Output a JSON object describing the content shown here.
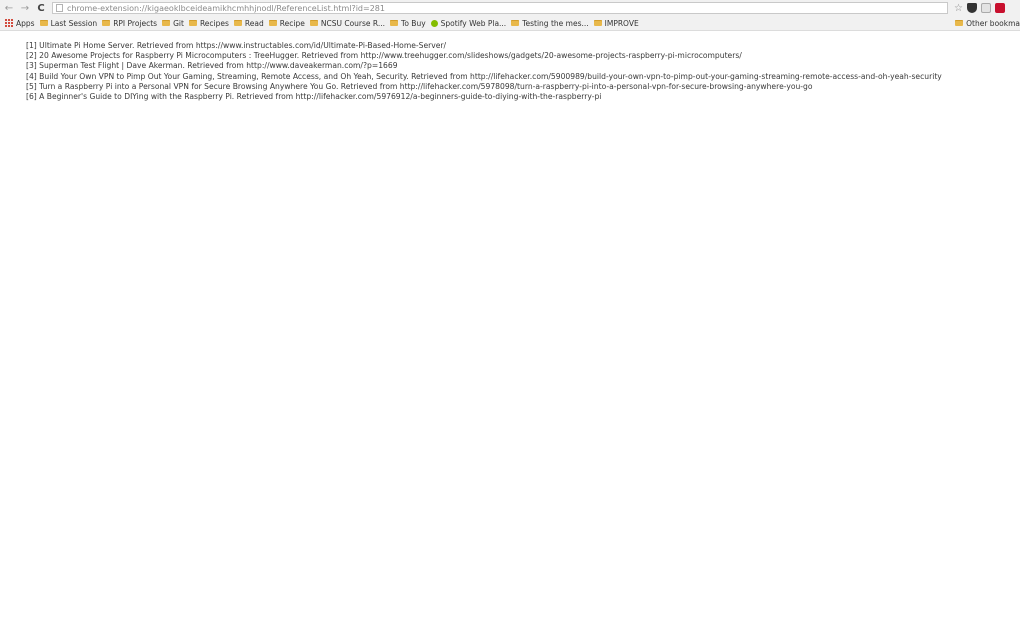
{
  "browser": {
    "back_icon": "←",
    "forward_icon": "→",
    "reload_icon": "C",
    "url": "chrome-extension://kigaeoklbceideamikhcmhhjnodl/ReferenceList.html?id=281",
    "star_icon": "☆"
  },
  "bookmarks": {
    "items": [
      {
        "label": "Apps",
        "type": "apps"
      },
      {
        "label": "Last Session",
        "type": "folder"
      },
      {
        "label": "RPI Projects",
        "type": "folder"
      },
      {
        "label": "Git",
        "type": "folder"
      },
      {
        "label": "Recipes",
        "type": "folder"
      },
      {
        "label": "Read",
        "type": "folder"
      },
      {
        "label": "Recipe",
        "type": "folder"
      },
      {
        "label": "NCSU Course R...",
        "type": "folder"
      },
      {
        "label": "To Buy",
        "type": "folder"
      },
      {
        "label": "Spotify Web Pla...",
        "type": "spotify"
      },
      {
        "label": "Testing the mes...",
        "type": "folder"
      },
      {
        "label": "IMPROVE",
        "type": "folder"
      }
    ],
    "other": "Other bookma"
  },
  "references": [
    "[1] Ultimate Pi Home Server. Retrieved from https://www.instructables.com/id/Ultimate-Pi-Based-Home-Server/",
    "[2] 20 Awesome Projects for Raspberry Pi Microcomputers : TreeHugger. Retrieved from http://www.treehugger.com/slideshows/gadgets/20-awesome-projects-raspberry-pi-microcomputers/",
    "[3] Superman Test Flight | Dave Akerman. Retrieved from http://www.daveakerman.com/?p=1669",
    "[4] Build Your Own VPN to Pimp Out Your Gaming, Streaming, Remote Access, and Oh Yeah, Security. Retrieved from http://lifehacker.com/5900989/build-your-own-vpn-to-pimp-out-your-gaming-streaming-remote-access-and-oh-yeah-security",
    "[5] Turn a Raspberry Pi into a Personal VPN for Secure Browsing Anywhere You Go. Retrieved from http://lifehacker.com/5978098/turn-a-raspberry-pi-into-a-personal-vpn-for-secure-browsing-anywhere-you-go",
    "[6] A Beginner's Guide to DIYing with the Raspberry Pi. Retrieved from http://lifehacker.com/5976912/a-beginners-guide-to-diying-with-the-raspberry-pi"
  ]
}
